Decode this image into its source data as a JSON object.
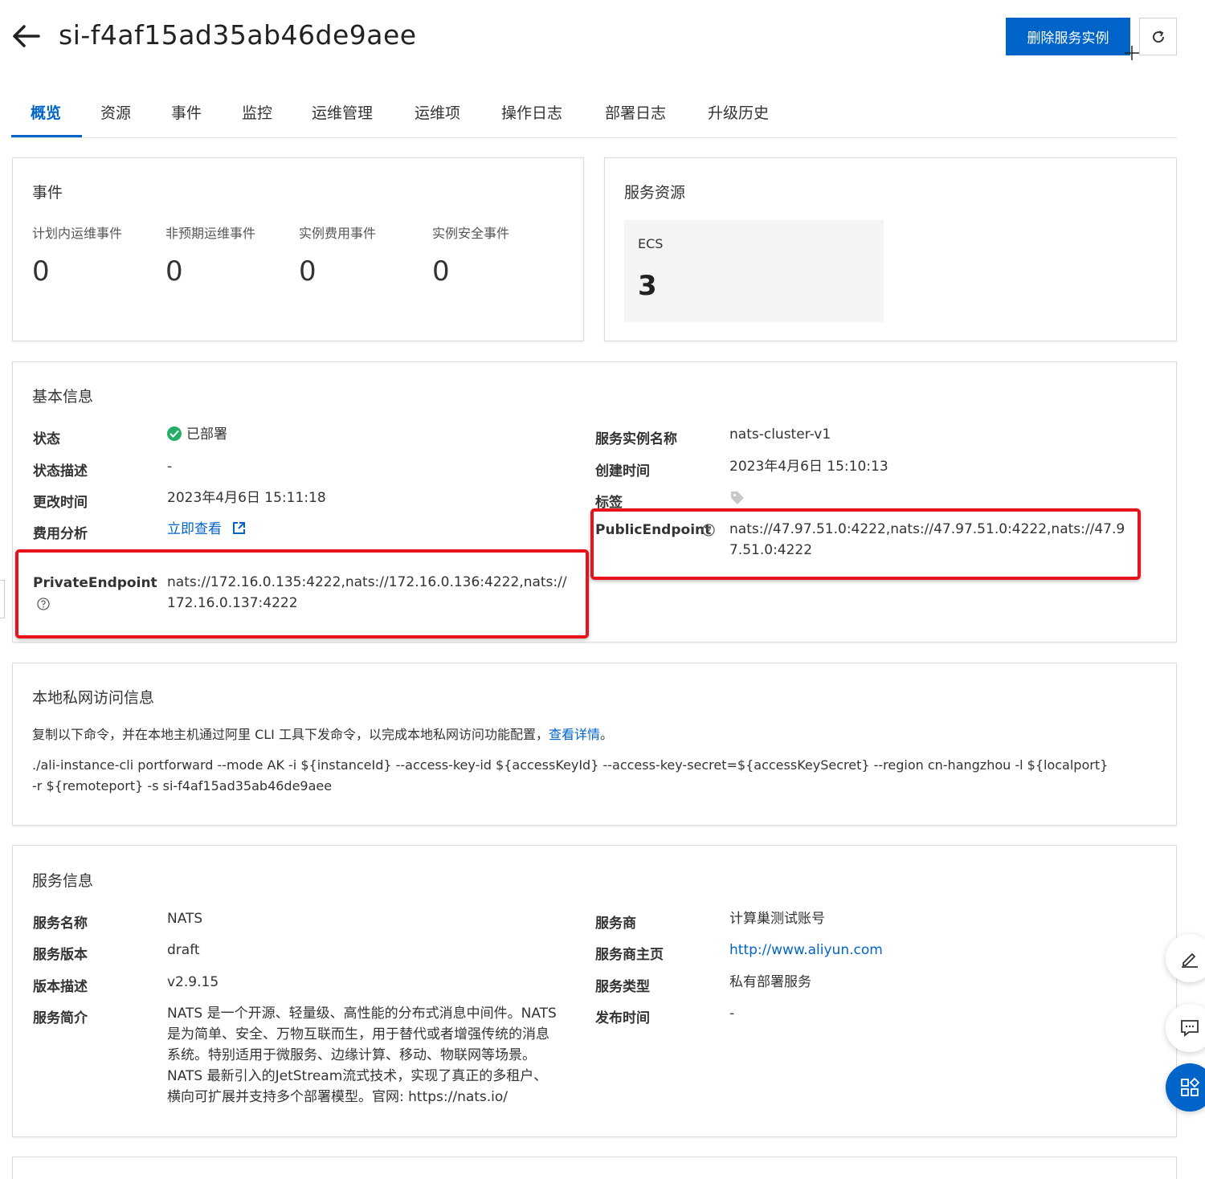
{
  "header": {
    "title": "si-f4af15ad35ab46de9aee",
    "delete_label": "删除服务实例"
  },
  "tabs": [
    {
      "label": "概览"
    },
    {
      "label": "资源"
    },
    {
      "label": "事件"
    },
    {
      "label": "监控"
    },
    {
      "label": "运维管理"
    },
    {
      "label": "运维项"
    },
    {
      "label": "操作日志"
    },
    {
      "label": "部署日志"
    },
    {
      "label": "升级历史"
    }
  ],
  "events": {
    "title": "事件",
    "items": [
      {
        "label": "计划内运维事件",
        "value": "0"
      },
      {
        "label": "非预期运维事件",
        "value": "0"
      },
      {
        "label": "实例费用事件",
        "value": "0"
      },
      {
        "label": "实例安全事件",
        "value": "0"
      }
    ]
  },
  "resources": {
    "title": "服务资源",
    "ecs_label": "ECS",
    "ecs_value": "3"
  },
  "basic": {
    "title": "基本信息",
    "status_key": "状态",
    "status_value": "已部署",
    "status_desc_key": "状态描述",
    "status_desc_value": "-",
    "modified_key": "更改时间",
    "modified_value": "2023年4月6日 15:11:18",
    "cost_key": "费用分析",
    "cost_link": "立即查看",
    "private_key": "PrivateEndpoint",
    "private_value_line1": "nats://172.16.0.135:4222,nats://172.16.0.136:4222,nats://",
    "private_value_line2": "172.16.0.137:4222",
    "name_key": "服务实例名称",
    "name_value": "nats-cluster-v1",
    "created_key": "创建时间",
    "created_value": "2023年4月6日 15:10:13",
    "tags_key": "标签",
    "public_key": "PublicEndpoint",
    "public_value_line1": "nats://47.97.51.0:4222,nats://47.97.51.0:4222,nats://47.9",
    "public_value_line2": "7.51.0:4222"
  },
  "local": {
    "title": "本地私网访问信息",
    "desc": "复制以下命令，并在本地主机通过阿里 CLI 工具下发命令，以完成本地私网访问功能配置，",
    "desc_link": "查看详情",
    "desc_end": "。",
    "cmd_line1": "./ali-instance-cli portforward --mode AK -i ${instanceId} --access-key-id ${accessKeyId} --access-key-secret=${accessKeySecret} --region cn-hangzhou -l ${localport}",
    "cmd_line2": "-r ${remoteport} -s si-f4af15ad35ab46de9aee"
  },
  "service": {
    "title": "服务信息",
    "name_key": "服务名称",
    "name_value": "NATS",
    "version_key": "服务版本",
    "version_value": "draft",
    "version_desc_key": "版本描述",
    "version_desc_value": "v2.9.15",
    "intro_key": "服务简介",
    "intro_lines": [
      "NATS 是一个开源、轻量级、高性能的分布式消息中间件。NATS",
      "是为简单、安全、万物互联而生，用于替代或者增强传统的消息",
      "系统。特别适用于微服务、边缘计算、移动、物联网等场景。",
      "NATS 最新引入的JetStream流式技术，实现了真正的多租户、",
      "横向可扩展并支持多个部署模型。官网: https://nats.io/"
    ],
    "provider_key": "服务商",
    "provider_value": "计算巢测试账号",
    "homepage_key": "服务商主页",
    "homepage_value": "http://www.aliyun.com",
    "type_key": "服务类型",
    "type_value": "私有部署服务",
    "publish_key": "发布时间",
    "publish_value": "-"
  },
  "colors": {
    "accent": "#0064c8",
    "success": "#23b066",
    "highlight": "#e8121b"
  },
  "icons": [
    "back-arrow-icon",
    "refresh-icon",
    "check-circle-icon",
    "external-link-icon",
    "question-circle-icon",
    "tag-icon",
    "edit-icon",
    "feedback-icon",
    "apps-icon"
  ]
}
